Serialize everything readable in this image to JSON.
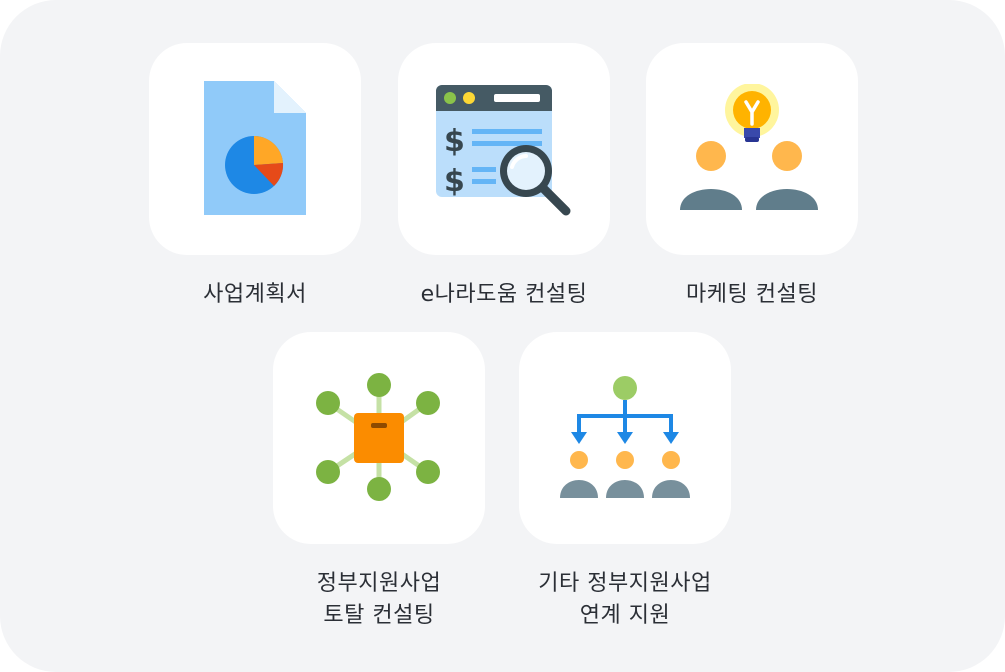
{
  "services": [
    {
      "label_lines": [
        "사업계획서"
      ],
      "icon": "business-plan-pie-chart-document-icon"
    },
    {
      "label_lines": [
        "e나라도움 컨설팅"
      ],
      "icon": "finance-search-magnifier-icon"
    },
    {
      "label_lines": [
        "마케팅 컨설팅"
      ],
      "icon": "people-lightbulb-idea-icon"
    },
    {
      "label_lines": [
        "정부지원사업",
        "토탈 컨설팅"
      ],
      "icon": "network-box-hub-icon"
    },
    {
      "label_lines": [
        "기타 정부지원사업",
        "연계 지원"
      ],
      "icon": "organization-hierarchy-icon"
    }
  ],
  "colors": {
    "background": "#f3f4f6",
    "card": "#ffffff",
    "text": "#2b2f36",
    "accent_blue": "#1e88e5",
    "accent_orange": "#ffa726",
    "accent_green": "#7cb342",
    "slate": "#607d8b"
  }
}
